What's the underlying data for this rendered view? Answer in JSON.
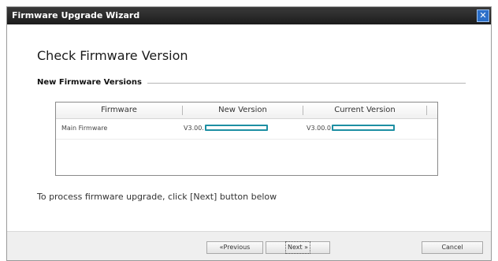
{
  "window": {
    "title": "Firmware Upgrade Wizard",
    "close_glyph": "✕"
  },
  "page": {
    "title": "Check Firmware Version",
    "section_label": "New Firmware Versions"
  },
  "grid": {
    "columns": [
      "Firmware",
      "New Version",
      "Current Version"
    ],
    "rows": [
      {
        "firmware": "Main Firmware",
        "new_version": "V3.00.",
        "current_version": "V3.00.0"
      }
    ]
  },
  "instructions": "To process firmware upgrade, click [Next] button below",
  "buttons": {
    "previous": "«Previous",
    "next": "Next »",
    "cancel": "Cancel"
  },
  "colors": {
    "titlebar": "#1c1c1c",
    "close_button": "#2b6fc9",
    "redaction_mark": "#1d8fa3",
    "footer": "#efefef"
  }
}
